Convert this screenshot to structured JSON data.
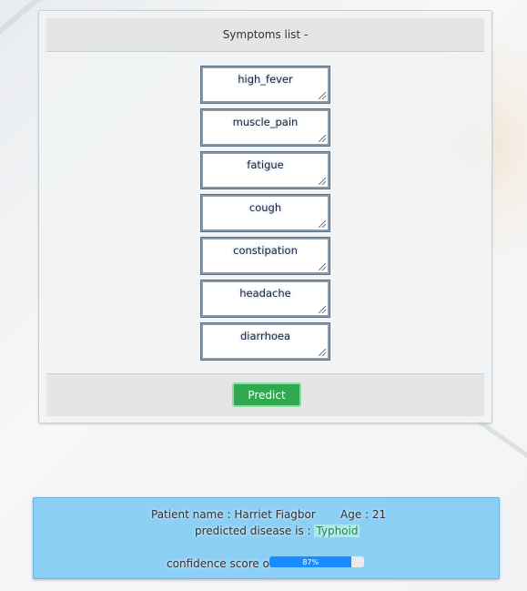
{
  "symptoms": {
    "header": "Symptoms list -",
    "items": [
      "high_fever",
      "muscle_pain",
      "fatigue",
      "cough",
      "constipation",
      "headache",
      "diarrhoea"
    ],
    "predict_label": "Predict"
  },
  "result": {
    "patient_label": "Patient name : ",
    "patient_name": "Harriet Fiagbor",
    "age_label": "Age : ",
    "age": "21",
    "disease_label": "predicted disease is : ",
    "disease": "Typhoid",
    "confidence_label": "confidence score of : ",
    "confidence_text": "87%",
    "confidence_value": 87
  },
  "colors": {
    "predict_button": "#2fa84f",
    "result_panel": "#8ccff5",
    "progress_fill": "#1a8cff",
    "disease_text": "#198754"
  }
}
